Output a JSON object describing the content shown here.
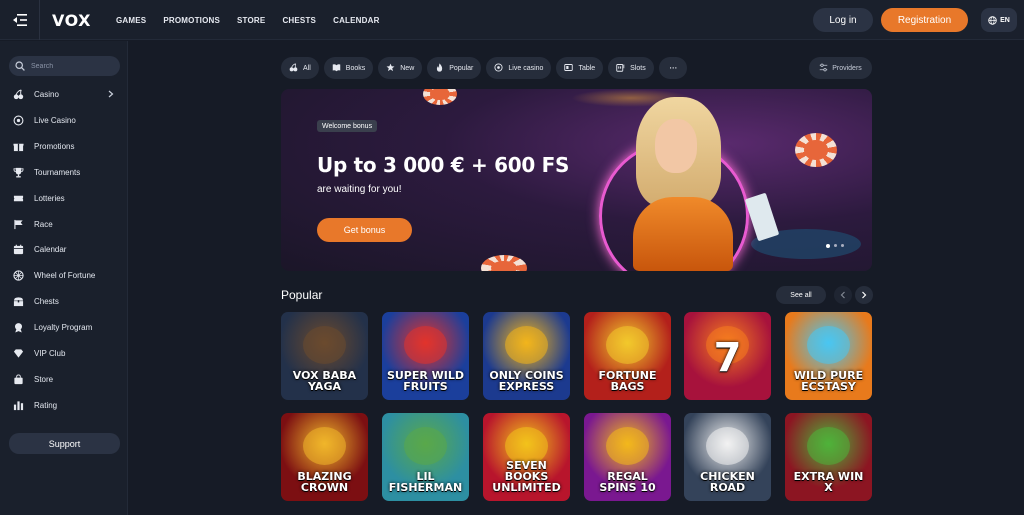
{
  "header": {
    "logo": "VOX",
    "nav": [
      "GAMES",
      "PROMOTIONS",
      "STORE",
      "CHESTS",
      "CALENDAR"
    ],
    "login_label": "Log in",
    "register_label": "Registration",
    "language": "EN"
  },
  "sidebar": {
    "search_placeholder": "Search",
    "items": [
      {
        "label": "Casino",
        "icon": "cherry-icon"
      },
      {
        "label": "Live Casino",
        "icon": "live-icon"
      },
      {
        "label": "Promotions",
        "icon": "gift-icon"
      },
      {
        "label": "Tournaments",
        "icon": "trophy-icon"
      },
      {
        "label": "Lotteries",
        "icon": "ticket-icon"
      },
      {
        "label": "Race",
        "icon": "flag-icon"
      },
      {
        "label": "Calendar",
        "icon": "calendar-icon"
      },
      {
        "label": "Wheel of Fortune",
        "icon": "wheel-icon"
      },
      {
        "label": "Chests",
        "icon": "chest-icon"
      },
      {
        "label": "Loyalty Program",
        "icon": "medal-icon"
      },
      {
        "label": "VIP Club",
        "icon": "diamond-icon"
      },
      {
        "label": "Store",
        "icon": "bag-icon"
      },
      {
        "label": "Rating",
        "icon": "bar-chart-icon"
      }
    ],
    "support_label": "Support"
  },
  "filters": {
    "chips": [
      {
        "label": "All",
        "icon": "cherry-icon"
      },
      {
        "label": "Books",
        "icon": "book-icon"
      },
      {
        "label": "New",
        "icon": "star-icon"
      },
      {
        "label": "Popular",
        "icon": "fire-icon"
      },
      {
        "label": "Live casino",
        "icon": "live-icon"
      },
      {
        "label": "Table",
        "icon": "table-icon"
      },
      {
        "label": "Slots",
        "icon": "slot-icon"
      }
    ],
    "more": "···",
    "providers_label": "Providers"
  },
  "banner": {
    "badge": "Welcome bonus",
    "headline": "Up to 3 000 € + 600 FS",
    "subtext": "are waiting for you!",
    "cta": "Get bonus"
  },
  "popular": {
    "title": "Popular",
    "see_all": "See all",
    "games": [
      {
        "title": "VOX BABA YAGA",
        "bg": "#23314a",
        "accent": "#6b4a2e"
      },
      {
        "title": "SUPER WILD FRUITS",
        "bg": "#1b3f9c",
        "accent": "#e2332b"
      },
      {
        "title": "ONLY COINS EXPRESS",
        "bg": "#1c3a8f",
        "accent": "#f2b51c"
      },
      {
        "title": "FORTUNE BAGS",
        "bg": "#b3201b",
        "accent": "#f2c92c"
      },
      {
        "title": "7",
        "bg": "#a7123c",
        "accent": "#f57c1f"
      },
      {
        "title": "WILD PURE ECSTASY",
        "bg": "#e87a1c",
        "accent": "#49c6f2"
      },
      {
        "title": "BLAZING CROWN",
        "bg": "#7c0f12",
        "accent": "#f0b62a"
      },
      {
        "title": "LIL FISHERMAN",
        "bg": "#2d8fa2",
        "accent": "#5aa84a"
      },
      {
        "title": "SEVEN BOOKS UNLIMITED",
        "bg": "#b8152c",
        "accent": "#f3c21b"
      },
      {
        "title": "REGAL SPINS 10",
        "bg": "#7a1890",
        "accent": "#f3b81c"
      },
      {
        "title": "CHICKEN ROAD",
        "bg": "#34435a",
        "accent": "#f2f2f2"
      },
      {
        "title": "EXTRA WIN X",
        "bg": "#8c1522",
        "accent": "#4fb33a"
      }
    ]
  }
}
